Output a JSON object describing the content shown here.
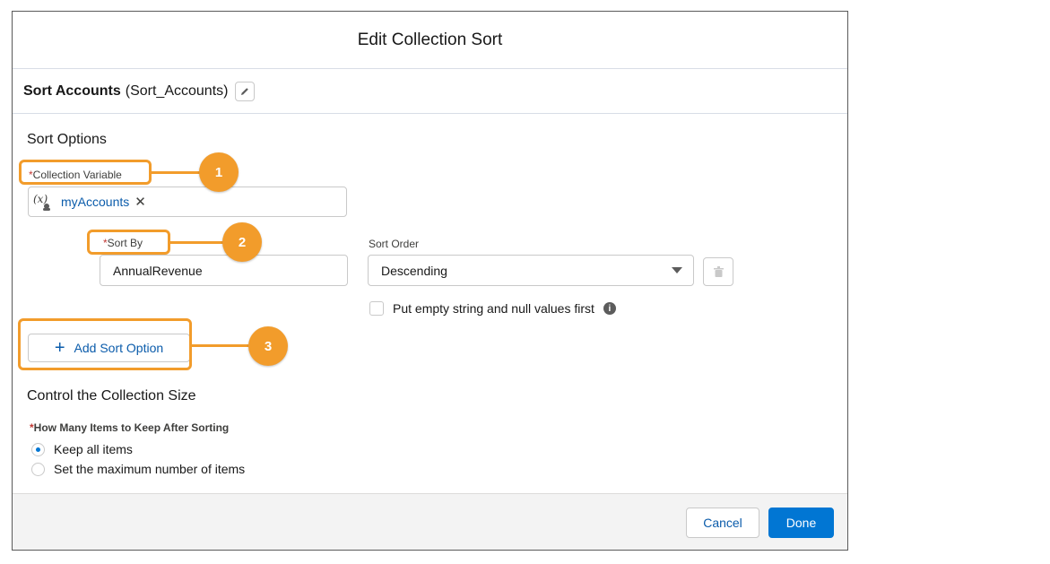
{
  "modal": {
    "title": "Edit Collection Sort"
  },
  "element": {
    "label": "Sort Accounts",
    "api_name": "(Sort_Accounts)"
  },
  "sort_options": {
    "section_title": "Sort Options",
    "collection_variable_label": "Collection Variable",
    "collection_variable_value": "myAccounts",
    "collection_variable_icon": "(x)",
    "sort_by_label": "Sort By",
    "sort_by_value": "AnnualRevenue",
    "sort_order_label": "Sort Order",
    "sort_order_value": "Descending",
    "nulls_first_label": "Put empty string and null values first",
    "add_sort_option_label": "Add Sort Option"
  },
  "collection_size": {
    "section_title": "Control the Collection Size",
    "question_label": "How Many Items to Keep After Sorting",
    "options": [
      {
        "label": "Keep all items",
        "selected": true
      },
      {
        "label": "Set the maximum number of items",
        "selected": false
      }
    ]
  },
  "callouts": [
    "1",
    "2",
    "3"
  ],
  "footer": {
    "cancel_label": "Cancel",
    "done_label": "Done"
  },
  "colors": {
    "brand": "#0176d3",
    "callout": "#f29c2b",
    "required": "#c23934"
  }
}
